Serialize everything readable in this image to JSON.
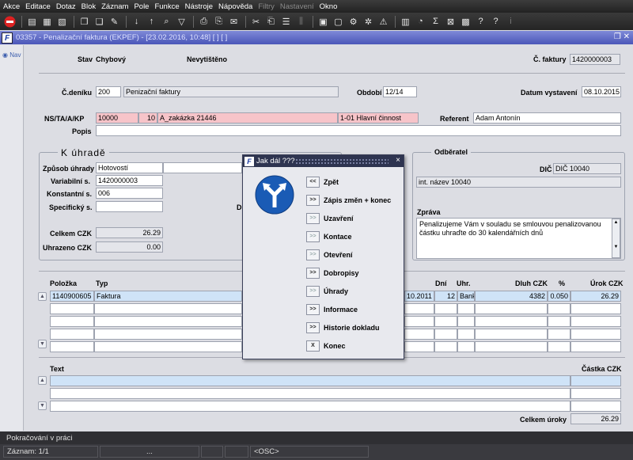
{
  "menu": [
    "Akce",
    "Editace",
    "Dotaz",
    "Blok",
    "Záznam",
    "Pole",
    "Funkce",
    "Nástroje",
    "Nápověda",
    "Filtry",
    "Nastavení",
    "Okno"
  ],
  "window": {
    "title": "03357 - Penalizační faktura (EKPEF) - [23.02.2016, 10:48] [ ] [ ]",
    "app_icon": "F"
  },
  "nav": {
    "label": "Nav"
  },
  "header": {
    "stav_label": "Stav",
    "stav_value": "Chybový",
    "print_status": "Nevytištěno",
    "cfaktury_label": "Č. faktury",
    "cfaktury_value": "1420000003"
  },
  "row2": {
    "cdeniku_label": "Č.deníku",
    "cdeniku_code": "200",
    "cdeniku_name": "Penizační faktury",
    "obdobi_label": "Období",
    "obdobi_value": "12/14",
    "datum_label": "Datum vystavení",
    "datum_value": "08.10.2015"
  },
  "row3": {
    "ns_label": "NS/TA/A/KP",
    "ns_value": "10000",
    "ta_value": "10",
    "a_value": "A_zakázka 21446",
    "kp_value": "1-01 Hlavní činnost",
    "referent_label": "Referent",
    "referent_value": "Adam Antonín",
    "popis_label": "Popis",
    "popis_value": ""
  },
  "kuhrade": {
    "title": "K úhradě",
    "zpusob_label": "Způsob úhrady",
    "zpusob_value": "Hotovostí",
    "variabilni_label": "Variabilní s.",
    "variabilni_value": "1420000003",
    "konstantni_label": "Konstantní s.",
    "konstantni_value": "006",
    "specificky_label": "Specifický s.",
    "specificky_value": "",
    "d_label": "D",
    "celkem_label": "Celkem CZK",
    "celkem_value": "26.29",
    "uhrazeno_label": "Uhrazeno CZK",
    "uhrazeno_value": "0.00"
  },
  "odberatel": {
    "title": "Odběratel",
    "dic_label": "DIČ",
    "dic_value": "DIČ 10040",
    "name_value": "int. název 10040",
    "zprava_label": "Zpráva",
    "zprava_text": "Penalizujeme Vám v souladu se smlouvou penalizovanou částku uhraďte do 30 kalendářních dnů"
  },
  "items": {
    "col_polozka": "Položka",
    "col_typ": "Typ",
    "col_dni": "Dní",
    "col_uhr": "Uhr.",
    "col_dluh": "Dluh CZK",
    "col_pct": "%",
    "col_urok": "Úrok CZK",
    "row": {
      "polozka": "1140900605",
      "typ": "Faktura",
      "datum": "10.2011",
      "dni": "12",
      "uhr": "Bank",
      "dluh": "4382",
      "pct": "0.050",
      "urok": "26.29"
    }
  },
  "texts": {
    "col_text": "Text",
    "col_castka": "Částka CZK",
    "celkem_uroky_label": "Celkem úroky",
    "celkem_uroky_value": "26.29"
  },
  "dialog": {
    "title": "Jak dál ???",
    "close": "×",
    "buttons": [
      {
        "glyph": "<<",
        "label": "Zpět",
        "enabled": true
      },
      {
        "glyph": ">>",
        "label": "Zápis změn + konec",
        "enabled": true
      },
      {
        "glyph": ">>",
        "label": "Uzavření",
        "enabled": false
      },
      {
        "glyph": ">>",
        "label": "Kontace",
        "enabled": false
      },
      {
        "glyph": ">>",
        "label": "Otevření",
        "enabled": false
      },
      {
        "glyph": ">>",
        "label": "Dobropisy",
        "enabled": true
      },
      {
        "glyph": ">>",
        "label": "Úhrady",
        "enabled": false
      },
      {
        "glyph": ">>",
        "label": "Informace",
        "enabled": true
      },
      {
        "glyph": ">>",
        "label": "Historie dokladu",
        "enabled": true
      },
      {
        "glyph": "X",
        "label": "Konec",
        "enabled": true
      }
    ]
  },
  "status": {
    "message": "Pokračování v práci",
    "record": "Záznam: 1/1",
    "cell2": "...",
    "osc": "<OSC>"
  }
}
